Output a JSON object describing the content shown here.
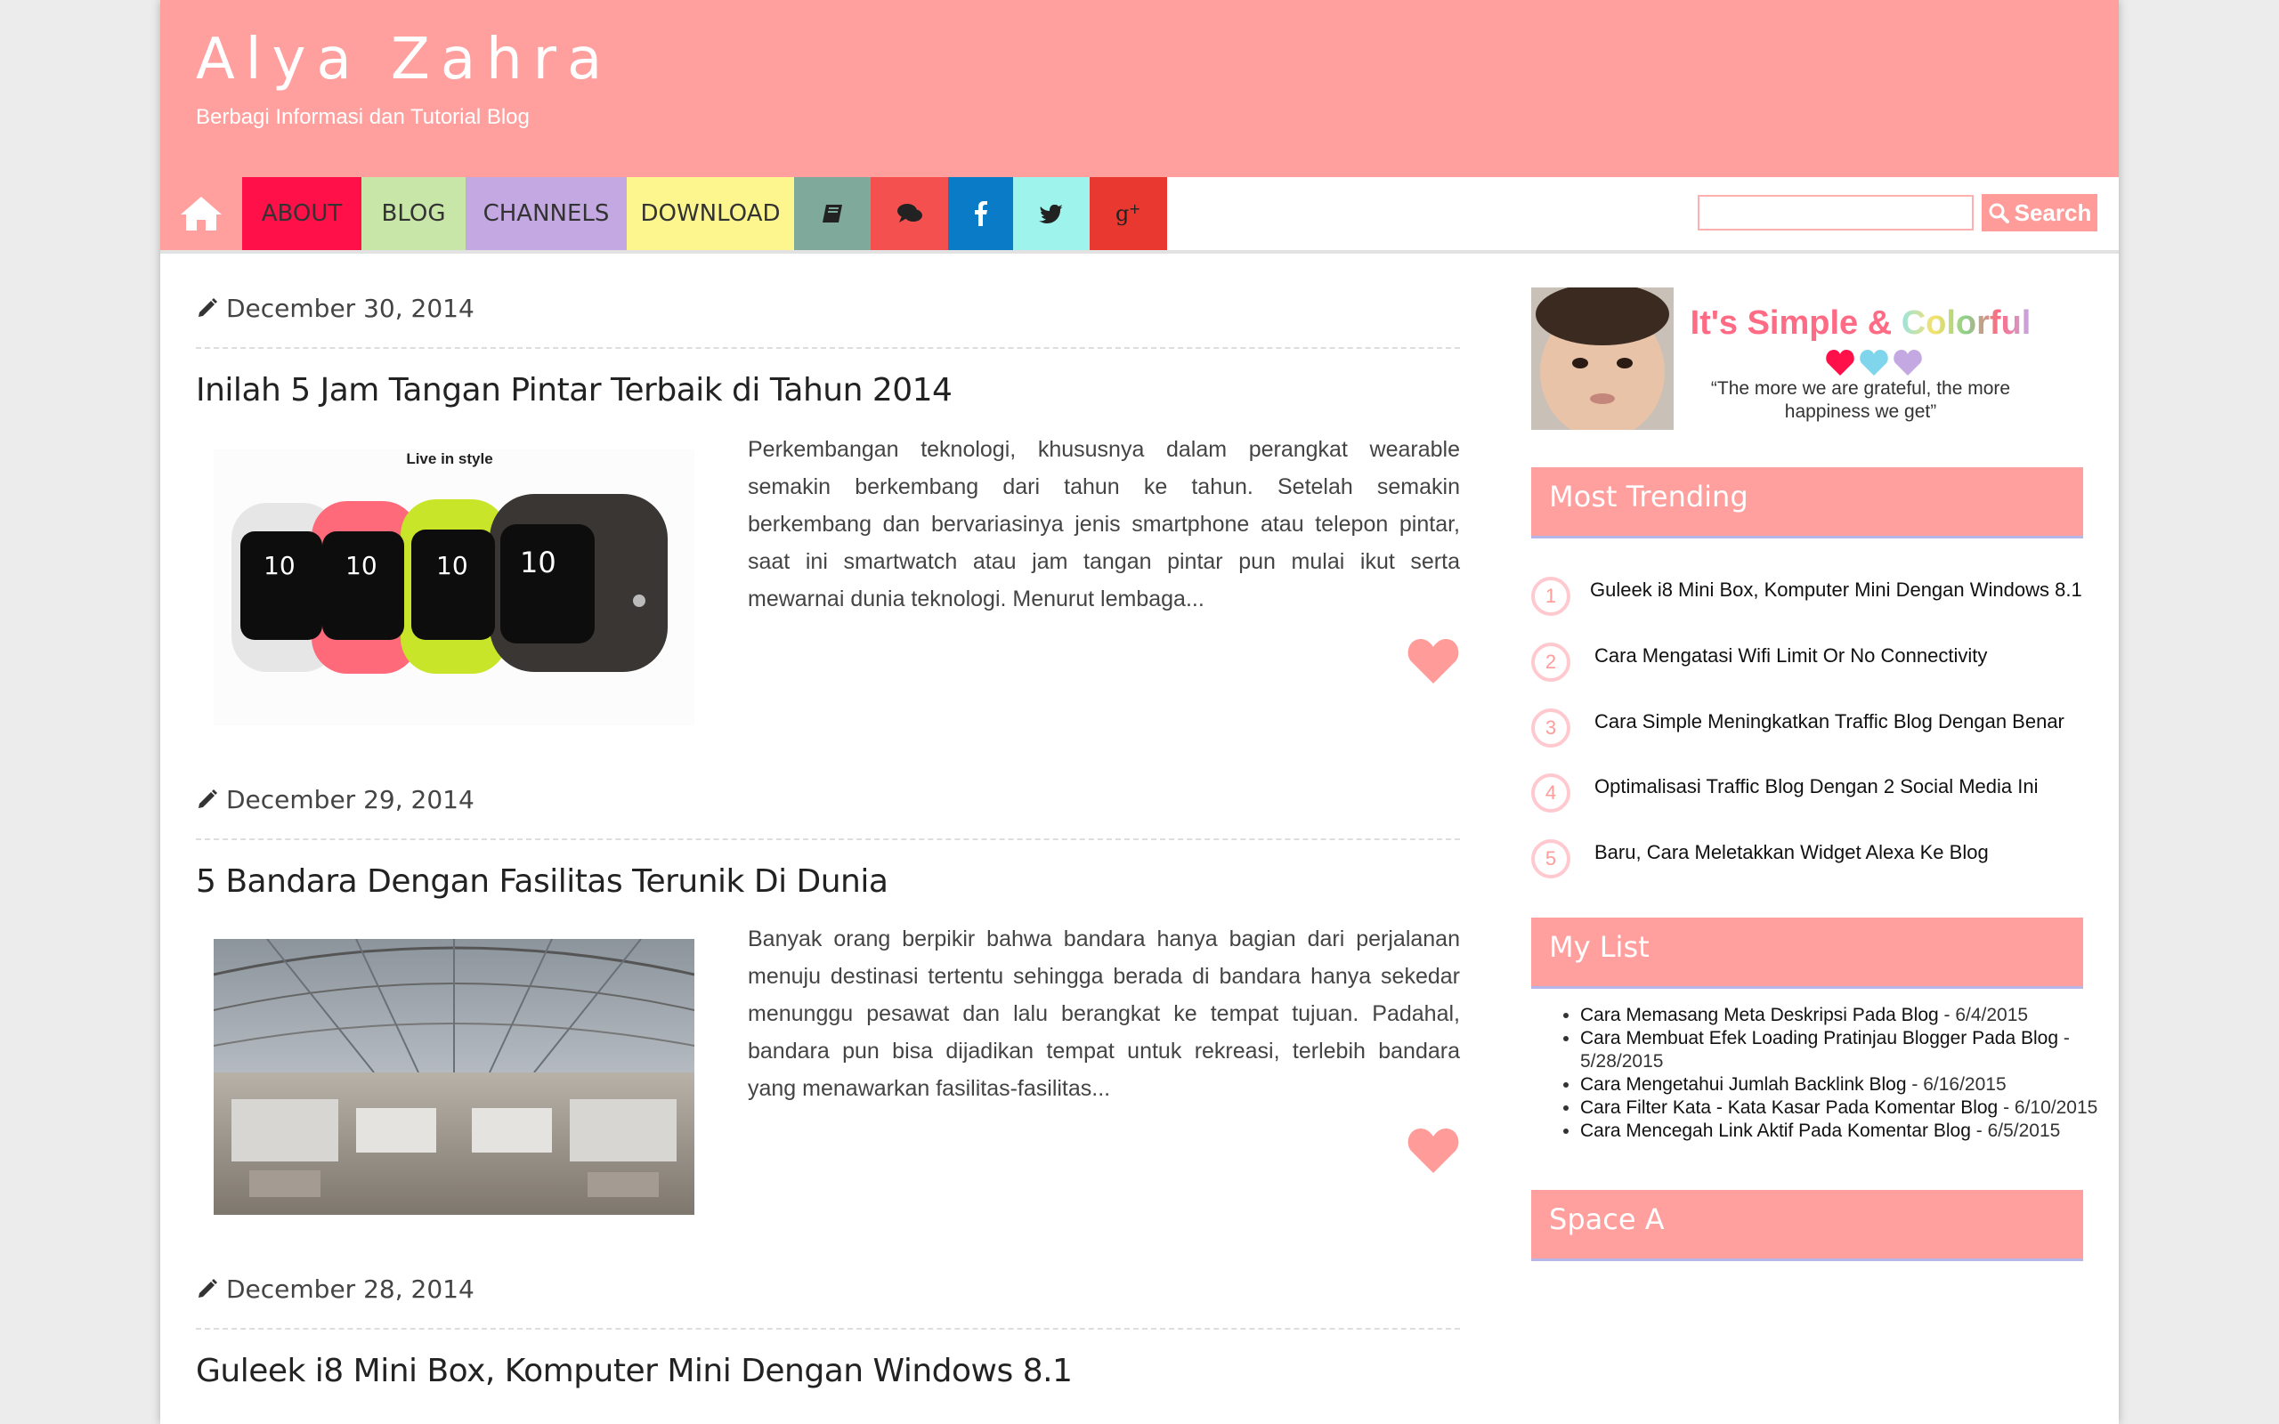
{
  "header": {
    "title": "Alya Zahra",
    "description": "Berbagi Informasi dan Tutorial Blog",
    "background_color": "#ffa09e"
  },
  "nav": {
    "home_icon": "home-icon",
    "items": [
      {
        "label": "ABOUT",
        "color": "#ff1048"
      },
      {
        "label": "BLOG",
        "color": "#c8e6a8"
      },
      {
        "label": "CHANNELS",
        "color": "#c4a8e2"
      },
      {
        "label": "DOWNLOAD",
        "color": "#fdf58e"
      }
    ],
    "icon_items": [
      {
        "icon": "book-icon",
        "color": "#7fa99b"
      },
      {
        "icon": "comments-icon",
        "color": "#f4504f"
      },
      {
        "icon": "facebook-icon",
        "color": "#0a7bc6"
      },
      {
        "icon": "twitter-icon",
        "color": "#9ef3ec"
      },
      {
        "icon": "google-plus-icon",
        "color": "#e8382f"
      }
    ],
    "search": {
      "button_label": "Search",
      "input_value": ""
    }
  },
  "posts": [
    {
      "date": "December 30, 2014",
      "title": "Inilah 5 Jam Tangan Pintar Terbaik di Tahun 2014",
      "image_caption": "Live in style",
      "excerpt": "Perkembangan teknologi, khususnya dalam perangkat wearable semakin berkembang dari tahun ke tahun. Setelah semakin berkembang dan bervariasinya jenis smartphone atau telepon pintar, saat ini smartwatch atau jam tangan pintar pun mulai ikut serta mewarnai dunia teknologi. Menurut lembaga..."
    },
    {
      "date": "December 29, 2014",
      "title": "5 Bandara Dengan Fasilitas Terunik Di Dunia",
      "excerpt": "Banyak orang berpikir bahwa bandara hanya bagian dari perjalanan menuju destinasi tertentu sehingga berada di bandara hanya sekedar menunggu pesawat dan lalu berangkat ke tempat tujuan. Padahal, bandara pun bisa dijadikan tempat untuk rekreasi, terlebih bandara yang menawarkan fasilitas-fasilitas..."
    },
    {
      "date": "December 28, 2014",
      "title": "Guleek i8 Mini Box, Komputer Mini Dengan Windows 8.1"
    }
  ],
  "watch_faces": [
    "10",
    "10",
    "10",
    "10"
  ],
  "sidebar": {
    "tagline": {
      "part1": "It's Simple & ",
      "part2": "Colorful"
    },
    "quote": "“The more we are grateful, the more happiness we get”",
    "trending": {
      "title": "Most Trending",
      "items": [
        {
          "num": "1",
          "label": "Guleek i8 Mini Box, Komputer Mini Dengan Windows 8.1"
        },
        {
          "num": "2",
          "label": "Cara Mengatasi Wifi Limit Or No Connectivity"
        },
        {
          "num": "3",
          "label": "Cara Simple Meningkatkan Traffic Blog Dengan Benar"
        },
        {
          "num": "4",
          "label": "Optimalisasi Traffic Blog Dengan 2 Social Media Ini"
        },
        {
          "num": "5",
          "label": "Baru, Cara Meletakkan Widget Alexa Ke Blog"
        }
      ]
    },
    "mylist": {
      "title": "My List",
      "items": [
        {
          "label": "Cara Memasang Meta Deskripsi Pada Blog",
          "date": " - 6/4/2015"
        },
        {
          "label": "Cara Membuat Efek Loading Pratinjau Blogger Pada Blog",
          "date": " - 5/28/2015"
        },
        {
          "label": "Cara Mengetahui Jumlah Backlink Blog",
          "date": " - 6/16/2015"
        },
        {
          "label": "Cara Filter Kata - Kata Kasar Pada Komentar Blog",
          "date": " - 6/10/2015"
        },
        {
          "label": "Cara Mencegah Link Aktif Pada Komentar Blog",
          "date": " - 6/5/2015"
        }
      ]
    },
    "space_a": {
      "title": "Space A"
    }
  }
}
